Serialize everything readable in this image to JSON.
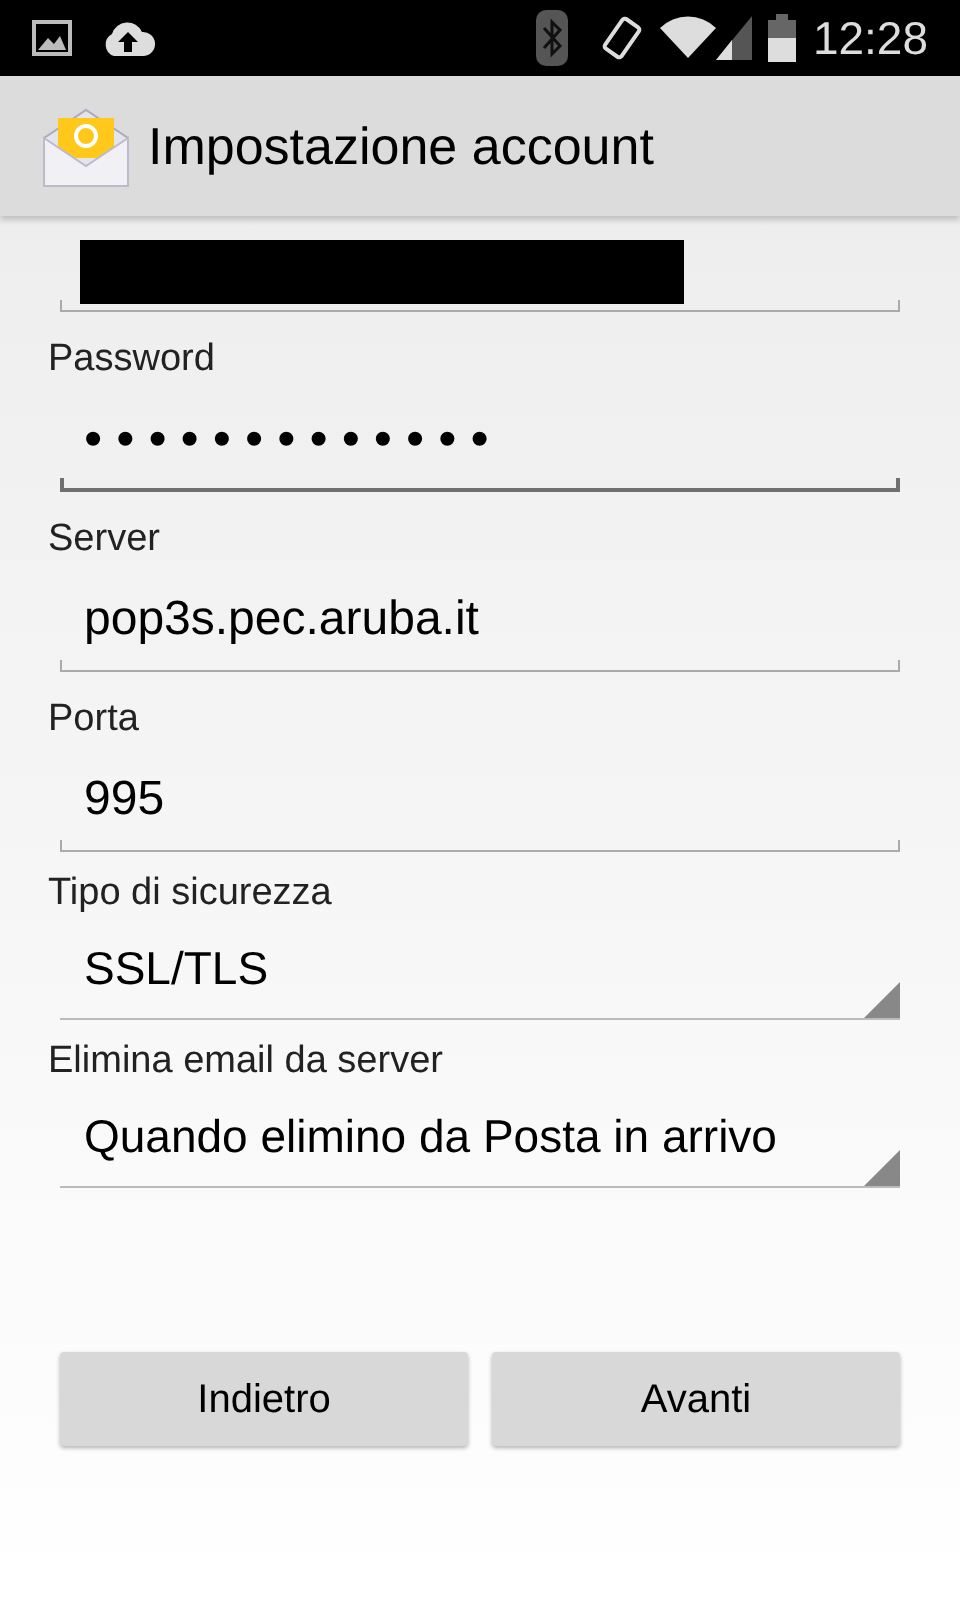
{
  "status_bar": {
    "time": "12:28"
  },
  "action_bar": {
    "title": "Impostazione account"
  },
  "fields": [
    {
      "kind": "redacted",
      "focused": false
    },
    {
      "kind": "password",
      "label": "Password",
      "value": "•••••••••••••",
      "focused": true
    },
    {
      "kind": "text",
      "label": "Server",
      "value": "pop3s.pec.aruba.it",
      "focused": false
    },
    {
      "kind": "text",
      "label": "Porta",
      "value": "995",
      "focused": false
    },
    {
      "kind": "dropdown",
      "label": "Tipo di sicurezza",
      "value": "SSL/TLS"
    },
    {
      "kind": "dropdown",
      "label": "Elimina email da server",
      "value": "Quando elimino da Posta in arrivo"
    }
  ],
  "buttons": [
    {
      "label": "Indietro"
    },
    {
      "label": "Avanti"
    }
  ]
}
